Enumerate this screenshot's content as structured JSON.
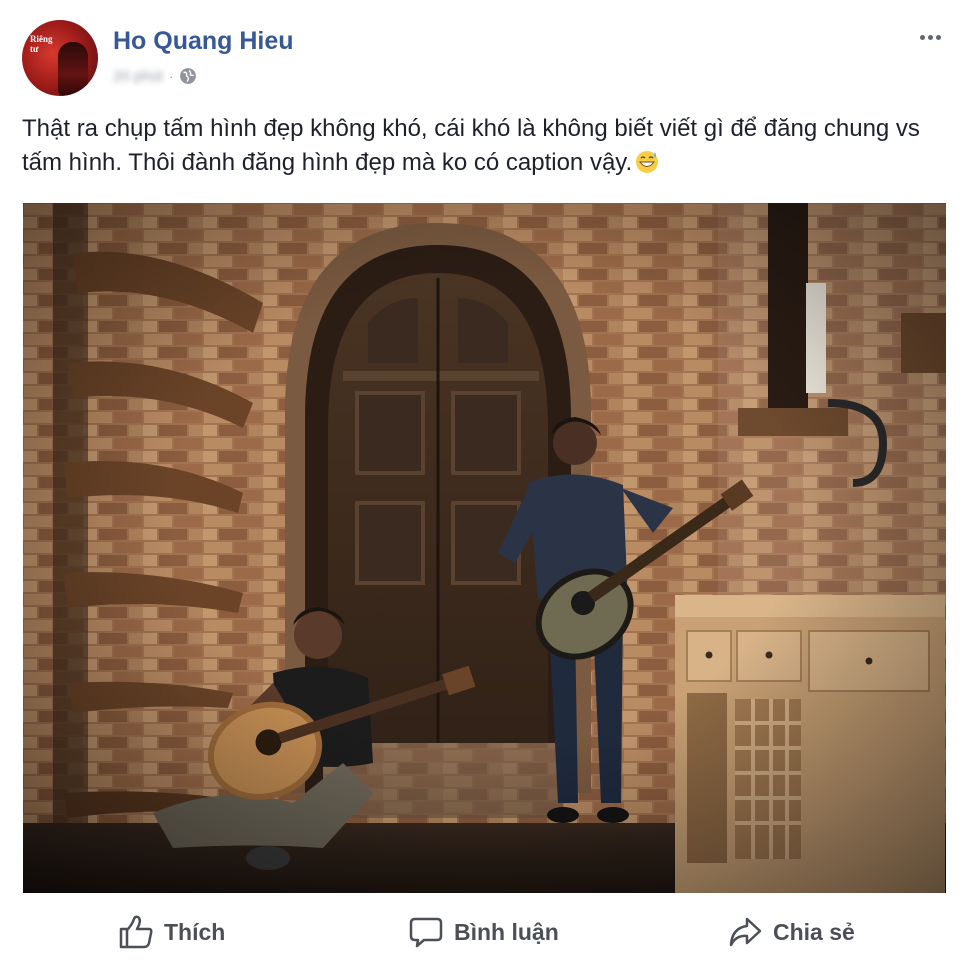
{
  "post": {
    "author": "Ho Quang Hieu",
    "avatar_badge": "Riêng tư",
    "time": "20 phút",
    "privacy_icon": "globe-icon",
    "text": "Thật ra chụp tấm hình đẹp không khó, cái khó là không biết viết gì để đăng chung vs tấm hình. Thôi đành đăng hình đẹp mà ko có caption vậy.",
    "emoji": "grinning-face-with-sweat-emoji",
    "more_icon": "more-options-icon"
  },
  "actions": {
    "like_label": "Thích",
    "comment_label": "Bình luận",
    "share_label": "Chia sẻ"
  },
  "colors": {
    "author": "#365899",
    "action_text": "#4b4f56",
    "body_text": "#1d2129"
  }
}
